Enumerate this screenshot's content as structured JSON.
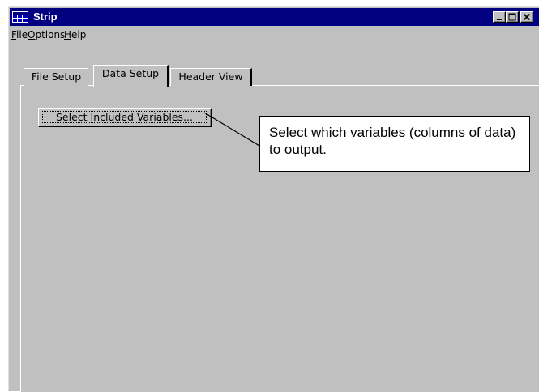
{
  "window": {
    "title": "Strip",
    "icon": "app-grid-icon",
    "caption_buttons": [
      "minimize-icon",
      "maximize-icon",
      "close-icon"
    ]
  },
  "menu": {
    "file": {
      "mnemonic": "F",
      "rest": "ile"
    },
    "options": {
      "mnemonic": "O",
      "rest": "ptions"
    },
    "help": {
      "mnemonic": "H",
      "rest": "elp"
    }
  },
  "tabs": [
    {
      "label": "File Setup",
      "selected": false
    },
    {
      "label": "Data Setup",
      "selected": true
    },
    {
      "label": "Header View",
      "selected": false
    }
  ],
  "data_setup": {
    "select_button_label": "Select Included Variables..."
  },
  "callout": {
    "text": "Select which variables (columns of data) to output."
  },
  "colors": {
    "title_bar": "#000080",
    "face": "#c0c0c0",
    "callout_background": "#ffffff"
  }
}
